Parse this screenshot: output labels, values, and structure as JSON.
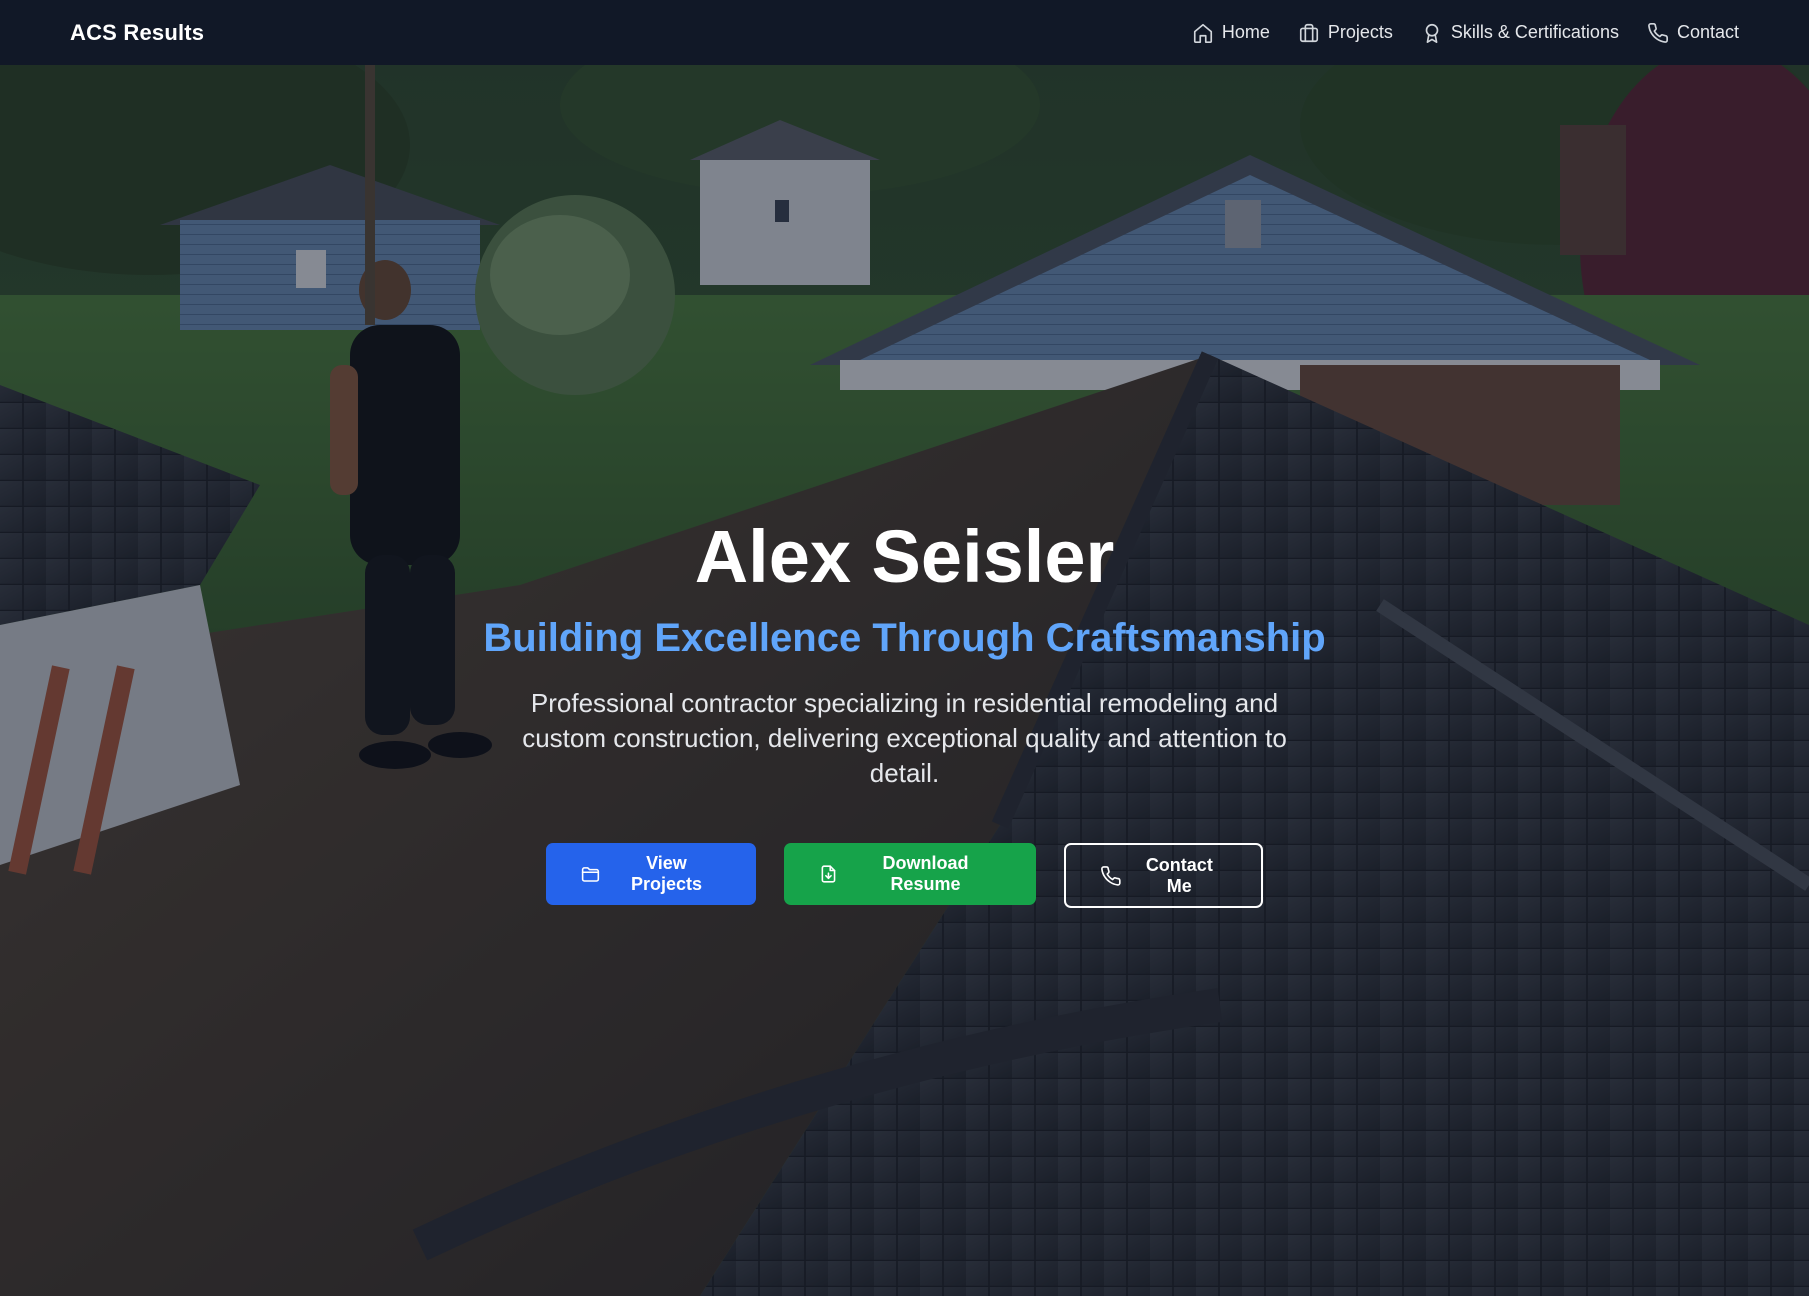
{
  "navbar": {
    "brand": "ACS Results",
    "links": [
      {
        "label": "Home",
        "icon": "home-icon"
      },
      {
        "label": "Projects",
        "icon": "briefcase-icon"
      },
      {
        "label": "Skills & Certifications",
        "icon": "award-icon"
      },
      {
        "label": "Contact",
        "icon": "phone-icon"
      }
    ]
  },
  "hero": {
    "title": "Alex Seisler",
    "subtitle": "Building Excellence Through Craftsmanship",
    "description": "Professional contractor specializing in residential remodeling and custom construction, delivering exceptional quality and attention to detail.",
    "background": "photo of a roofing job site: a worker standing on a partially re-shingled roof overlooking suburban houses",
    "actions": [
      {
        "label": "View Projects",
        "icon": "folder-icon",
        "color": "#2563eb"
      },
      {
        "label": "Download Resume",
        "icon": "file-download-icon",
        "color": "#16a34a"
      },
      {
        "label": "Contact Me",
        "icon": "phone-icon",
        "color": "transparent"
      }
    ]
  },
  "colors": {
    "navbar_bg": "#111827",
    "accent_blue": "#60a5fa",
    "primary": "#2563eb",
    "success": "#16a34a"
  }
}
